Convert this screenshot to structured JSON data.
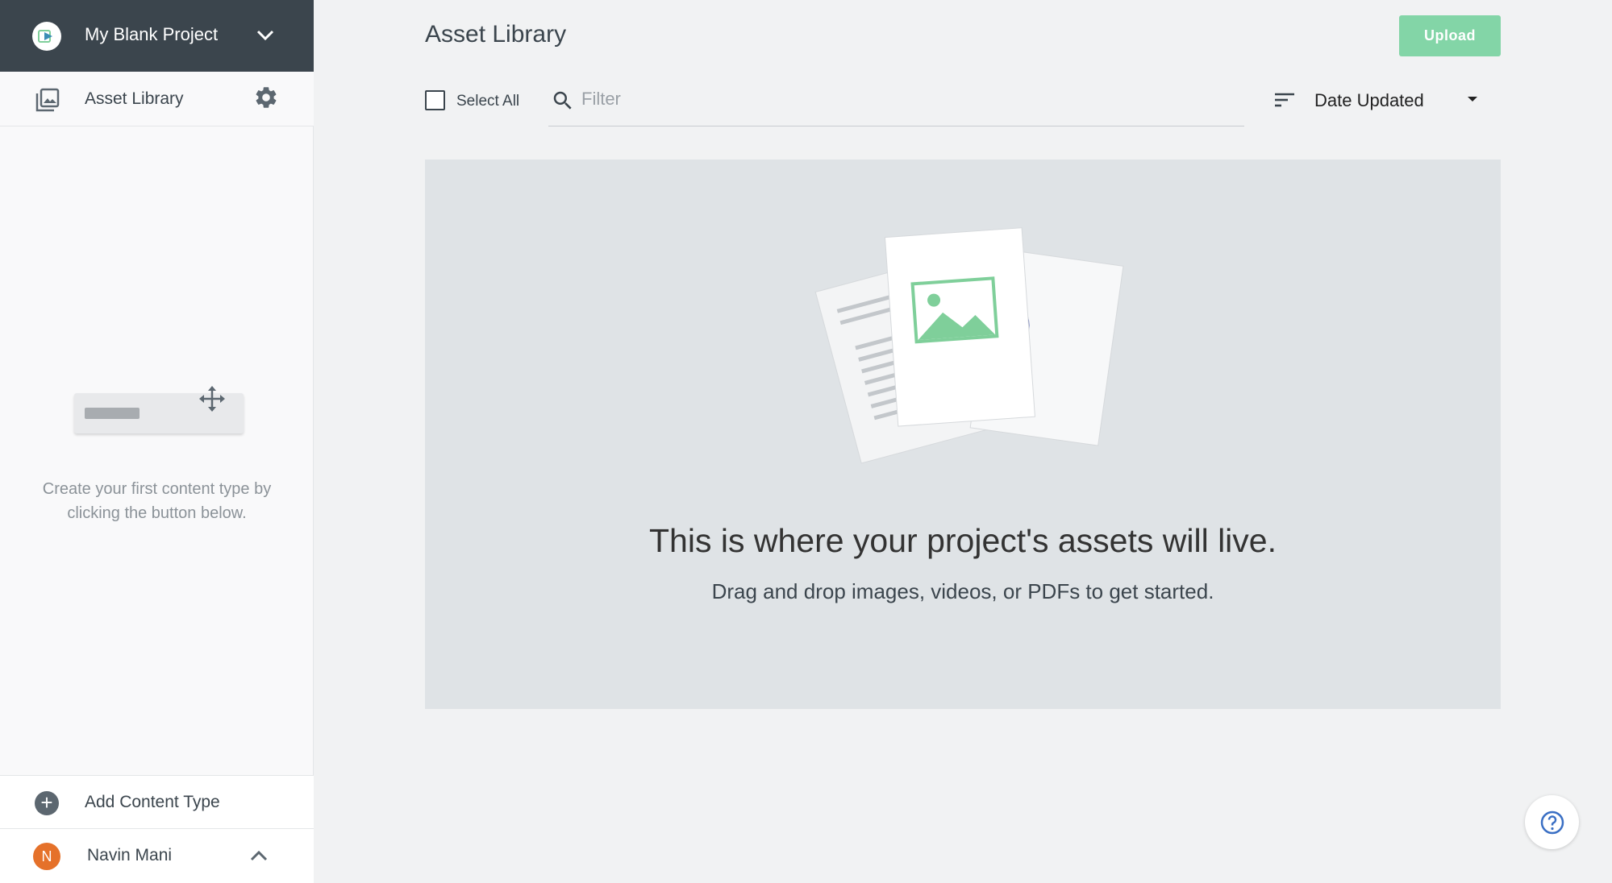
{
  "sidebar": {
    "project_name": "My Blank Project",
    "nav": [
      {
        "label": "Asset Library",
        "icon": "image-stack-icon"
      }
    ],
    "empty_hint": "Create your first content type by clicking the button below.",
    "add_content_type": "Add Content Type",
    "user": {
      "name": "Navin Mani",
      "initial": "N",
      "avatar_color": "#e5712a"
    }
  },
  "main": {
    "title": "Asset Library",
    "upload_label": "Upload",
    "select_all_label": "Select All",
    "filter": {
      "placeholder": "Filter",
      "value": ""
    },
    "sort": {
      "label": "Date Updated"
    },
    "empty_state": {
      "title": "This is where your project's assets will live.",
      "subtitle": "Drag and drop images, videos, or PDFs to get started."
    }
  },
  "colors": {
    "header_bg": "#3b454d",
    "accent_green": "#83d5a7",
    "illustration_green": "#7fcf9a",
    "play_blue": "#3a4aa0",
    "avatar_orange": "#e5712a"
  }
}
